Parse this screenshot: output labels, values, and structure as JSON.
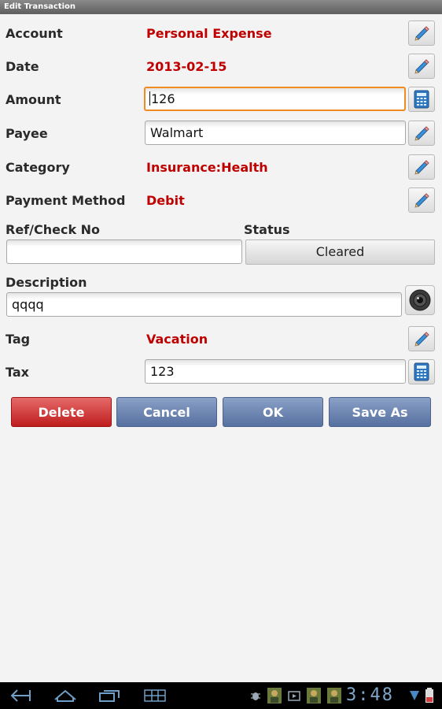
{
  "window": {
    "title": "Edit Transaction"
  },
  "form": {
    "account": {
      "label": "Account",
      "value": "Personal Expense"
    },
    "date": {
      "label": "Date",
      "value": "2013-02-15"
    },
    "amount": {
      "label": "Amount",
      "value": "126"
    },
    "payee": {
      "label": "Payee",
      "value": "Walmart"
    },
    "category": {
      "label": "Category",
      "value": "Insurance:Health"
    },
    "payment_method": {
      "label": "Payment Method",
      "value": "Debit"
    },
    "ref_check": {
      "label": "Ref/Check No",
      "value": ""
    },
    "status": {
      "label": "Status",
      "value": "Cleared"
    },
    "description": {
      "label": "Description",
      "value": "qqqq"
    },
    "tag": {
      "label": "Tag",
      "value": "Vacation"
    },
    "tax": {
      "label": "Tax",
      "value": "123"
    }
  },
  "actions": {
    "delete": "Delete",
    "cancel": "Cancel",
    "ok": "OK",
    "save_as": "Save As"
  },
  "system_bar": {
    "time": "3:48"
  },
  "colors": {
    "value_red": "#c00000",
    "delete_red": "#bf1d1d",
    "action_blue": "#5670a0",
    "focus_orange": "#f08c1f"
  }
}
